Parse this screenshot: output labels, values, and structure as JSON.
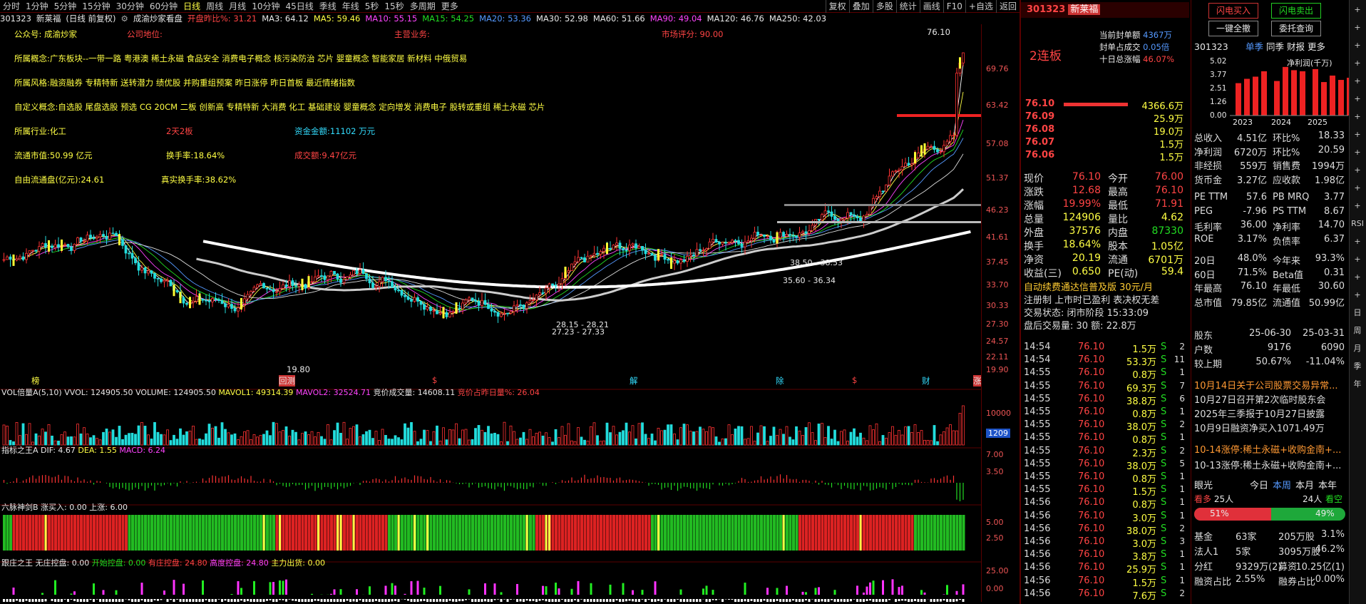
{
  "topbar": {
    "periods": [
      "分时",
      "1分钟",
      "5分钟",
      "15分钟",
      "30分钟",
      "60分钟",
      "日线",
      "周线",
      "月线",
      "10分钟",
      "45日线",
      "季线",
      "年线",
      "5秒",
      "15秒",
      "多周期",
      "更多"
    ],
    "tools": [
      "复权",
      "叠加",
      "多股",
      "统计",
      "画线",
      "F10",
      "+自选",
      "返回"
    ]
  },
  "header": {
    "code": "301323",
    "name": "新莱福",
    "suffix": "(日线 前复权)",
    "subtitle": "成渝炒家看盘",
    "pct": "开盘昨比%: 31.21",
    "ma3": "MA3: 64.12",
    "ma5": "MA5: 59.46",
    "ma10": "MA10: 55.15",
    "ma15": "MA15: 54.25",
    "ma20": "MA20: 53.36",
    "ma30": "MA30: 52.98",
    "ma60": "MA60: 51.66",
    "ma90": "MA90: 49.04",
    "ma120": "MA120: 46.76",
    "ma250": "MA250: 42.03"
  },
  "overlay": {
    "l1a": "公众号: 成渝炒家",
    "l1b": "公司地位:",
    "l1c": "主营业务:",
    "l1d": "市场评分: 90.00",
    "l2": "所属概念:广东板块--一带一路 粤港澳 稀土永磁 食品安全 消费电子概念 核污染防治 芯片 婴童概念 智能家居 新材料 中俄贸易",
    "l3": "所属风格:融资融券 专精特新 送转潜力 绩优股 并购重组预案 昨日涨停 昨日首板 最近情绪指数",
    "l4": "自定义概念:自选股 尾盘选股 预选 CG 20CM 二板 创新高 专精特新 大消费 化工 基础建设 婴童概念 定向增发 消费电子 股转或重组 稀土永磁 芯片",
    "l5a": "所属行业:化工",
    "l5b": "2天2板",
    "l5c": "资金金额:11102 万元",
    "l6a": "流通市值:50.99 亿元",
    "l6b": "换手率:18.64%",
    "l6c": "成交额:9.47亿元",
    "l7a": "自由流通盘(亿元):24.61",
    "l7b": "真实换手率:38.62%"
  },
  "price_axis": [
    "76.10",
    "69.76",
    "63.42",
    "57.08",
    "51.37",
    "46.23",
    "41.61",
    "37.45",
    "33.70",
    "30.33",
    "27.30",
    "24.57",
    "22.11",
    "19.90"
  ],
  "annotations": {
    "high": "76.10",
    "low": "19.80",
    "box1": "38.50 - 38.53",
    "box2": "35.60 - 36.34",
    "box3": "28.15 - 28.21",
    "box4": "27.23 - 27.33"
  },
  "event_marks": [
    "榜",
    "回测",
    "$",
    "解",
    "除",
    "$",
    "财",
    "涨"
  ],
  "vol": {
    "title": "VOL倍量A(5,10)",
    "vvol": "VVOL: 124905.50",
    "volume": "VOLUME: 124905.50",
    "mavol1": "MAVOL1: 49314.39",
    "mavol2": "MAVOL2: 32524.71",
    "jj": "竞价成交量: 14608.11",
    "ratio": "竞价占昨日量%: 26.04",
    "axis": "10000",
    "badge": "1209"
  },
  "macd": {
    "title": "指标之王A",
    "dif": "DIF: 4.67",
    "dea": "DEA: 1.55",
    "macd": "MACD: 6.24",
    "a1": "7.00",
    "a2": "3.50"
  },
  "six": {
    "title": "六脉神剑B",
    "buy": "涨买入: 0.00",
    "up": "上涨: 6.00",
    "a1": "5.00",
    "a2": "2.50"
  },
  "zhuang": {
    "title": "跟庄之王",
    "w": "无庄控盘: 0.00",
    "k": "开始控盘: 0.00",
    "y": "有庄控盘: 24.80",
    "g": "高度控盘: 24.80",
    "z": "主力出货: 0.00",
    "a1": "25.00",
    "a2": "0.00"
  },
  "quote": {
    "code": "301323",
    "name": "新莱福",
    "boards": "2连板",
    "d1": "当前封单额",
    "d1v": "4367万",
    "d2": "封单占成交",
    "d2v": "0.05倍",
    "d3": "十日总涨幅",
    "d3v": "46.07%",
    "asks": [
      [
        "76.10",
        "4366.6万"
      ],
      [
        "76.09",
        "25.9万"
      ],
      [
        "76.08",
        "19.0万"
      ],
      [
        "76.07",
        "1.5万"
      ],
      [
        "76.06",
        "1.5万"
      ]
    ],
    "stats": [
      [
        "现价",
        "76.10",
        "今开",
        "76.00"
      ],
      [
        "涨跌",
        "12.68",
        "最高",
        "76.10"
      ],
      [
        "涨幅",
        "19.99%",
        "最低",
        "71.91"
      ],
      [
        "总量",
        "124906",
        "量比",
        "4.62"
      ],
      [
        "外盘",
        "37576",
        "内盘",
        "87330"
      ],
      [
        "换手",
        "18.64%",
        "股本",
        "1.05亿"
      ],
      [
        "净资",
        "20.19",
        "流通",
        "6701万"
      ],
      [
        "收益(三)",
        "0.650",
        "PE(动)",
        "59.4"
      ]
    ],
    "ad": "自动续费通达信普及版 30元/月",
    "ad2": "注册制 上市时已盈利 表决权无差",
    "state": "交易状态: 闭市阶段 15:33:09",
    "after": "盘后交易量: 30 额: 22.8万"
  },
  "ticks": [
    [
      "14:54",
      "76.10",
      "1.5万",
      "S",
      "2"
    ],
    [
      "14:54",
      "76.10",
      "53.3万",
      "S",
      "11"
    ],
    [
      "14:55",
      "76.10",
      "0.8万",
      "S",
      "1"
    ],
    [
      "14:55",
      "76.10",
      "69.3万",
      "S",
      "7"
    ],
    [
      "14:55",
      "76.10",
      "38.8万",
      "S",
      "6"
    ],
    [
      "14:55",
      "76.10",
      "0.8万",
      "S",
      "1"
    ],
    [
      "14:55",
      "76.10",
      "38.0万",
      "S",
      "2"
    ],
    [
      "14:55",
      "76.10",
      "0.8万",
      "S",
      "1"
    ],
    [
      "14:55",
      "76.10",
      "2.3万",
      "S",
      "2"
    ],
    [
      "14:55",
      "76.10",
      "38.0万",
      "S",
      "5"
    ],
    [
      "14:55",
      "76.10",
      "0.8万",
      "S",
      "1"
    ],
    [
      "14:55",
      "76.10",
      "1.5万",
      "S",
      "1"
    ],
    [
      "14:56",
      "76.10",
      "0.8万",
      "S",
      "1"
    ],
    [
      "14:56",
      "76.10",
      "3.0万",
      "S",
      "1"
    ],
    [
      "14:56",
      "76.10",
      "38.0万",
      "S",
      "2"
    ],
    [
      "14:56",
      "76.10",
      "3.0万",
      "S",
      "3"
    ],
    [
      "14:56",
      "76.10",
      "3.8万",
      "S",
      "1"
    ],
    [
      "14:56",
      "76.10",
      "25.9万",
      "S",
      "1"
    ],
    [
      "14:56",
      "76.10",
      "1.5万",
      "S",
      "1"
    ],
    [
      "14:56",
      "76.10",
      "7.6万",
      "S",
      "2"
    ]
  ],
  "right": {
    "btn1": "闪电买入",
    "btn2": "闪电卖出",
    "btn3": "一键全撤",
    "btn4": "委托查询",
    "code": "301323",
    "tabs": [
      "单季",
      "同季",
      "财报",
      "更多"
    ],
    "bars_title": "净利润(千万)",
    "bars_y": [
      "5.02",
      "3.77",
      "2.51",
      "1.26",
      "0.00"
    ],
    "years": [
      "2023",
      "2024",
      "2025"
    ],
    "fin": [
      [
        "总收入",
        "4.51亿",
        "环比%",
        "18.33"
      ],
      [
        "净利润",
        "6720万",
        "环比%",
        "20.59"
      ],
      [
        "非经损",
        "559万",
        "销售费",
        "1994万"
      ],
      [
        "货币金",
        "3.27亿",
        "应收款",
        "1.98亿"
      ],
      [
        "PE TTM",
        "57.6",
        "PB MRQ",
        "3.77"
      ],
      [
        "PEG",
        "-7.96",
        "PS TTM",
        "8.67"
      ],
      [
        "毛利率",
        "36.00",
        "净利率",
        "14.70"
      ],
      [
        "ROE",
        "3.17%",
        "负债率",
        "6.37"
      ],
      [
        "20日",
        "48.0%",
        "今年来",
        "93.3%"
      ],
      [
        "60日",
        "71.5%",
        "Beta值",
        "0.31"
      ],
      [
        "年最高",
        "76.10",
        "年最低",
        "30.60"
      ],
      [
        "总市值",
        "79.85亿",
        "流通值",
        "50.99亿"
      ]
    ],
    "holders": [
      [
        "股东",
        "25-06-30",
        "25-03-31"
      ],
      [
        "户数",
        "9176",
        "6090"
      ],
      [
        "较上期",
        "50.67%",
        "-11.04%"
      ]
    ],
    "news": [
      "10月14日关于公司股票交易异常...",
      "10月27日召开第2次临时股东会",
      "2025年三季报于10月27日披露",
      "10月9日融资净买入1071.49万"
    ],
    "limit": [
      "10-14涨停:稀土永磁+收购金南+...",
      "10-13涨停:稀土永磁+收购金南+..."
    ],
    "eye": "眼光",
    "period": [
      "今日",
      "本周",
      "本月",
      "本年"
    ],
    "bull": "看多",
    "bulln": "25人",
    "bearn": "24人",
    "bear": "看空",
    "bullp": "51%",
    "bearp": "49%",
    "inst": [
      [
        "基金",
        "63家",
        "205万股",
        "3.1%"
      ],
      [
        "法人1",
        "5家",
        "3095万股",
        "46.2%"
      ],
      [
        "分红",
        "9329万(2)",
        "募资",
        "10.25亿(1)"
      ],
      [
        "融资占比",
        "2.55%",
        "融券占比",
        "0.00%"
      ]
    ]
  },
  "toolstrip": [
    "+",
    "+",
    "+",
    "+",
    "+",
    "+",
    "+",
    "+",
    "+",
    "+",
    "+",
    "+",
    "RSI",
    "+",
    "+",
    "+",
    "+",
    "日",
    "周",
    "月",
    "季",
    "年"
  ]
}
